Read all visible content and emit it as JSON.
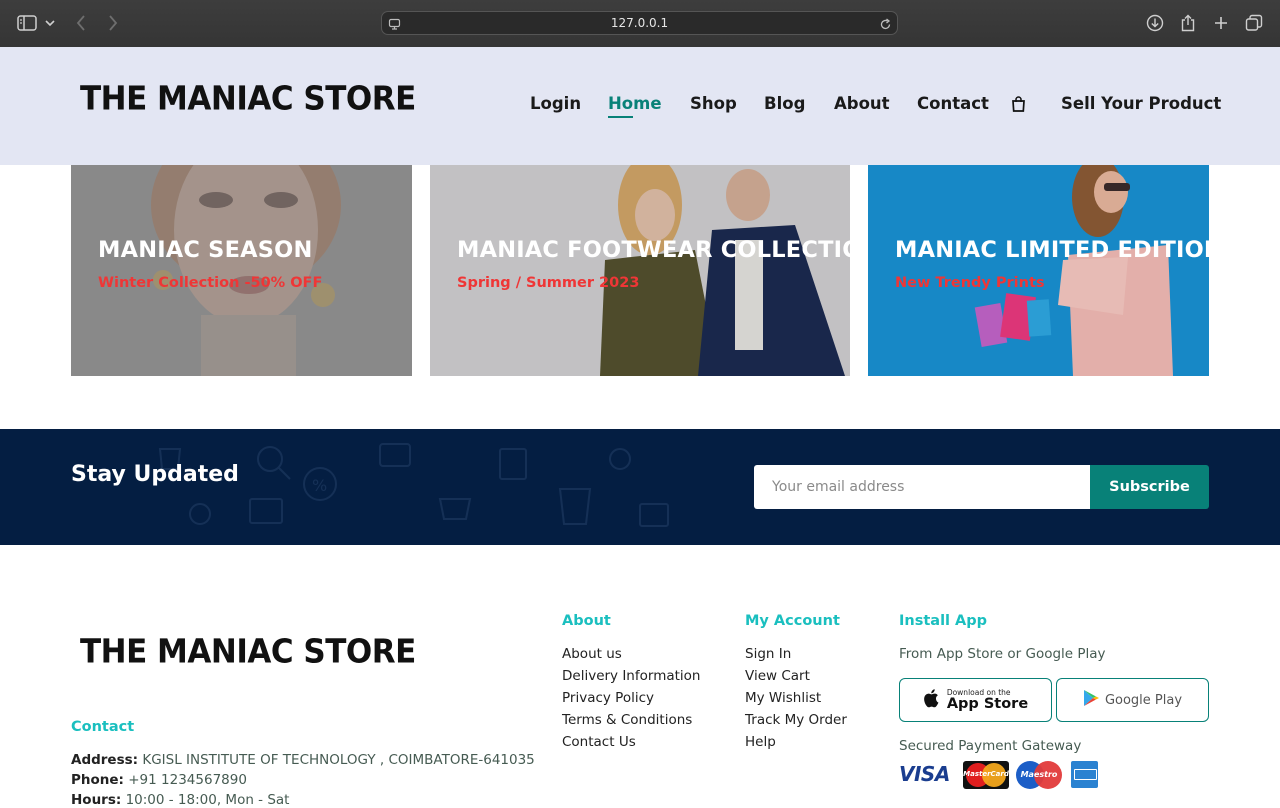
{
  "browser": {
    "url": "127.0.0.1"
  },
  "header": {
    "logo_text": "THE MANIAC STORE",
    "nav": [
      {
        "label": "Login"
      },
      {
        "label": "Home"
      },
      {
        "label": "Shop"
      },
      {
        "label": "Blog"
      },
      {
        "label": "About"
      },
      {
        "label": "Contact"
      },
      {
        "label": "Sell Your Product"
      }
    ],
    "active_nav": "Home"
  },
  "banners": [
    {
      "title": "MANIAC SEASON",
      "subtitle": "Winter Collection -50% OFF"
    },
    {
      "title": "MANIAC FOOTWEAR COLLECTION",
      "subtitle": "Spring / Summer 2023"
    },
    {
      "title": "MANIAC LIMITED EDITION",
      "subtitle": "New Trendy Prints"
    }
  ],
  "newsletter": {
    "title": "Stay Updated",
    "placeholder": "Your email address",
    "button": "Subscribe"
  },
  "footer": {
    "logo_text": "THE MANIAC STORE",
    "contact": {
      "title": "Contact",
      "address_label": "Address:",
      "address": "KGISL INSTITUTE OF TECHNOLOGY , COIMBATORE-641035",
      "phone_label": "Phone:",
      "phone": "+91 1234567890",
      "hours_label": "Hours:",
      "hours": "10:00 - 18:00, Mon - Sat"
    },
    "about": {
      "title": "About",
      "links": [
        "About us",
        "Delivery Information",
        "Privacy Policy",
        "Terms & Conditions",
        "Contact Us"
      ]
    },
    "account": {
      "title": "My Account",
      "links": [
        "Sign In",
        "View Cart",
        "My Wishlist",
        "Track My Order",
        "Help"
      ]
    },
    "install": {
      "title": "Install App",
      "text": "From App Store or Google Play",
      "app_store_small": "Download on the",
      "app_store_big": "App Store",
      "google_play": "Google Play",
      "payment_title": "Secured Payment Gateway",
      "cards": {
        "visa": "VISA",
        "mastercard": "MasterCard",
        "maestro": "Maestro"
      }
    }
  },
  "colors": {
    "accent": "#088178",
    "footer_title": "#1abfbf",
    "banner_subtitle": "#ef3636",
    "newsletter_bg": "#041e42",
    "header_bg": "#e3e6f3"
  }
}
